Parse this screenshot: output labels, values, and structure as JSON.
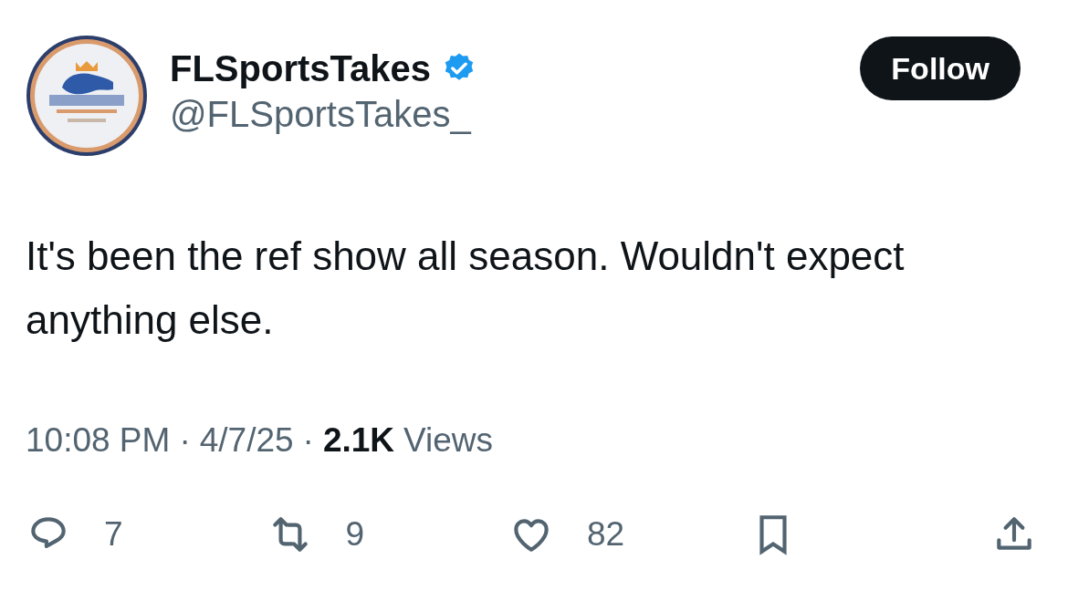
{
  "author": {
    "name": "FLSportsTakes",
    "verified": true,
    "handle": "@FLSportsTakes_"
  },
  "follow_button": {
    "label": "Follow"
  },
  "text": "It's been the ref show all season. Wouldn't expect anything else.",
  "meta": {
    "time": "10:08 PM",
    "separator": "·",
    "date": "4/7/25",
    "views_count": "2.1K",
    "views_label": "Views"
  },
  "actions": [
    {
      "kind": "reply",
      "count": "7"
    },
    {
      "kind": "repost",
      "count": "9"
    },
    {
      "kind": "like",
      "count": "82"
    },
    {
      "kind": "bookmark"
    },
    {
      "kind": "share"
    }
  ]
}
